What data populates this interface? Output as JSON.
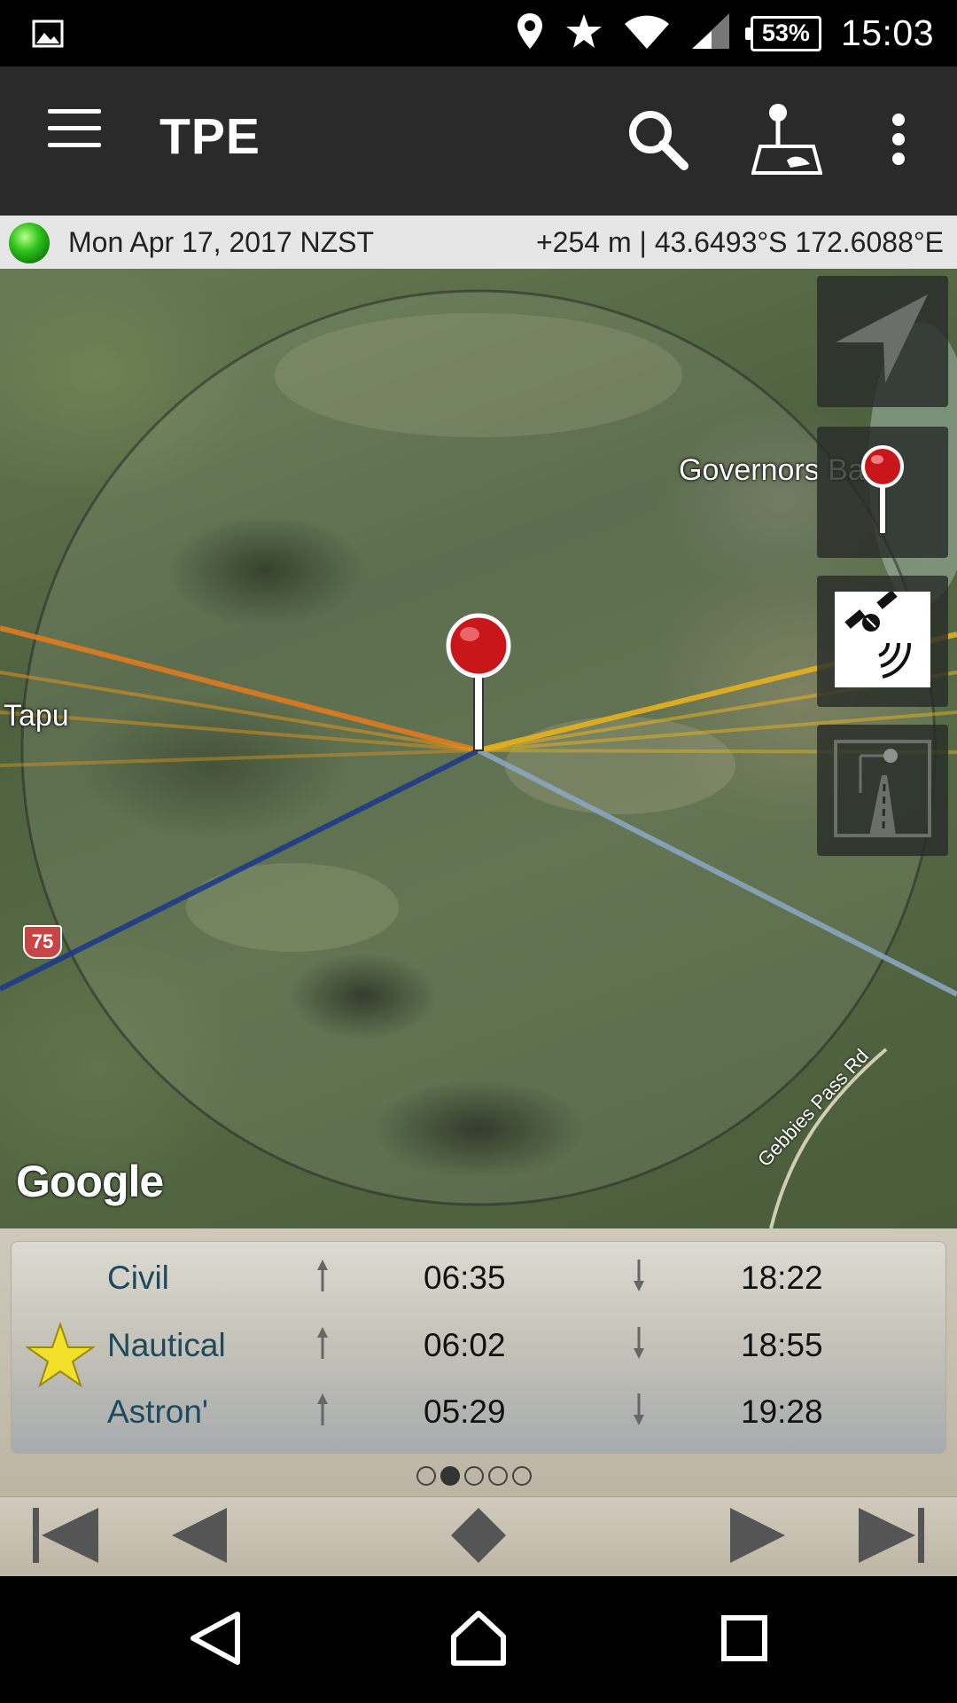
{
  "status_bar": {
    "battery": "53%",
    "time": "15:03",
    "icons": [
      "gallery-icon",
      "location-pin-icon",
      "star-icon",
      "wifi-icon",
      "signal-icon",
      "battery-icon"
    ]
  },
  "app_bar": {
    "title": "TPE",
    "actions": [
      "search-icon",
      "pin-on-map-icon",
      "overflow-menu-icon"
    ]
  },
  "info": {
    "date": "Mon Apr 17, 2017 NZST",
    "location": "+254 m | 43.6493°S 172.6088°E"
  },
  "map": {
    "labels": {
      "place_1": "Governors Ba",
      "place_2": "Tapu",
      "road_shield": "75",
      "road_name": "Gebbies Pass Rd"
    },
    "attribution": "Google",
    "side_buttons": [
      "my-location-arrow-icon",
      "red-pin-icon",
      "satellite-layer-icon",
      "street-view-icon"
    ],
    "line_colors": {
      "sunrise": "#e07b1f",
      "sunset": "#e8b21e",
      "moonrise": "#1f3a8a",
      "moonset": "#8aa6c0"
    }
  },
  "twilight": {
    "rows": [
      {
        "name": "Civil",
        "rise": "06:35",
        "set": "18:22"
      },
      {
        "name": "Nautical",
        "rise": "06:02",
        "set": "18:55"
      },
      {
        "name": "Astron'",
        "rise": "05:29",
        "set": "19:28"
      }
    ],
    "page_index": 1,
    "page_count": 5
  },
  "time_nav": [
    "skip-to-start-icon",
    "step-back-icon",
    "now-diamond-icon",
    "step-forward-icon",
    "skip-to-end-icon"
  ],
  "system_nav": [
    "back-icon",
    "home-icon",
    "recents-icon"
  ]
}
